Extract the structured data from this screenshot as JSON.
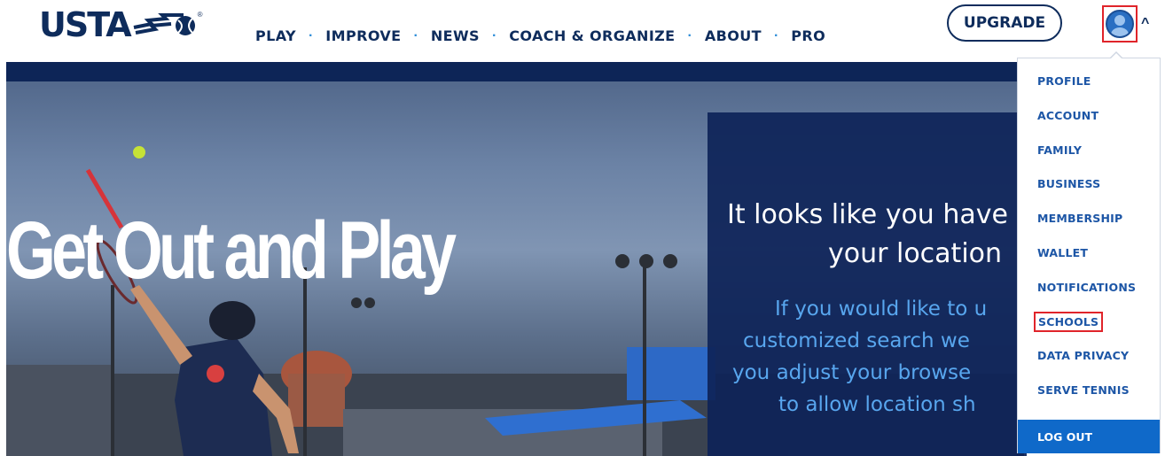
{
  "brand": {
    "logo_text": "USTA",
    "logo_icon": "tennis-ball-swoosh-icon",
    "color": "#0e2c5c"
  },
  "nav": {
    "items": [
      "PLAY",
      "IMPROVE",
      "NEWS",
      "COACH & ORGANIZE",
      "ABOUT",
      "PRO"
    ],
    "separator": "·"
  },
  "header": {
    "upgrade_label": "UPGRADE",
    "account_icon": "user-avatar-icon",
    "caret_icon": "chevron-up-icon",
    "caret_glyph": "^"
  },
  "hero": {
    "title": "Get Out and Play"
  },
  "location_prompt": {
    "heading_lines": [
      "It looks like you have",
      "your location"
    ],
    "body_lines": [
      "If you would like to u",
      "customized search we",
      "you adjust your browse",
      "to allow location sh"
    ]
  },
  "account_menu": {
    "items": [
      "PROFILE",
      "ACCOUNT",
      "FAMILY",
      "BUSINESS",
      "MEMBERSHIP",
      "WALLET",
      "NOTIFICATIONS",
      "SCHOOLS",
      "DATA PRIVACY",
      "SERVE TENNIS"
    ],
    "highlighted": "SCHOOLS",
    "logout_label": "LOG OUT"
  },
  "colors": {
    "navy": "#0e2c5c",
    "menu_link": "#1d56a6",
    "logout_bg": "#0f69c9",
    "highlight": "#e0242a",
    "body_text": "#58a6ee"
  }
}
